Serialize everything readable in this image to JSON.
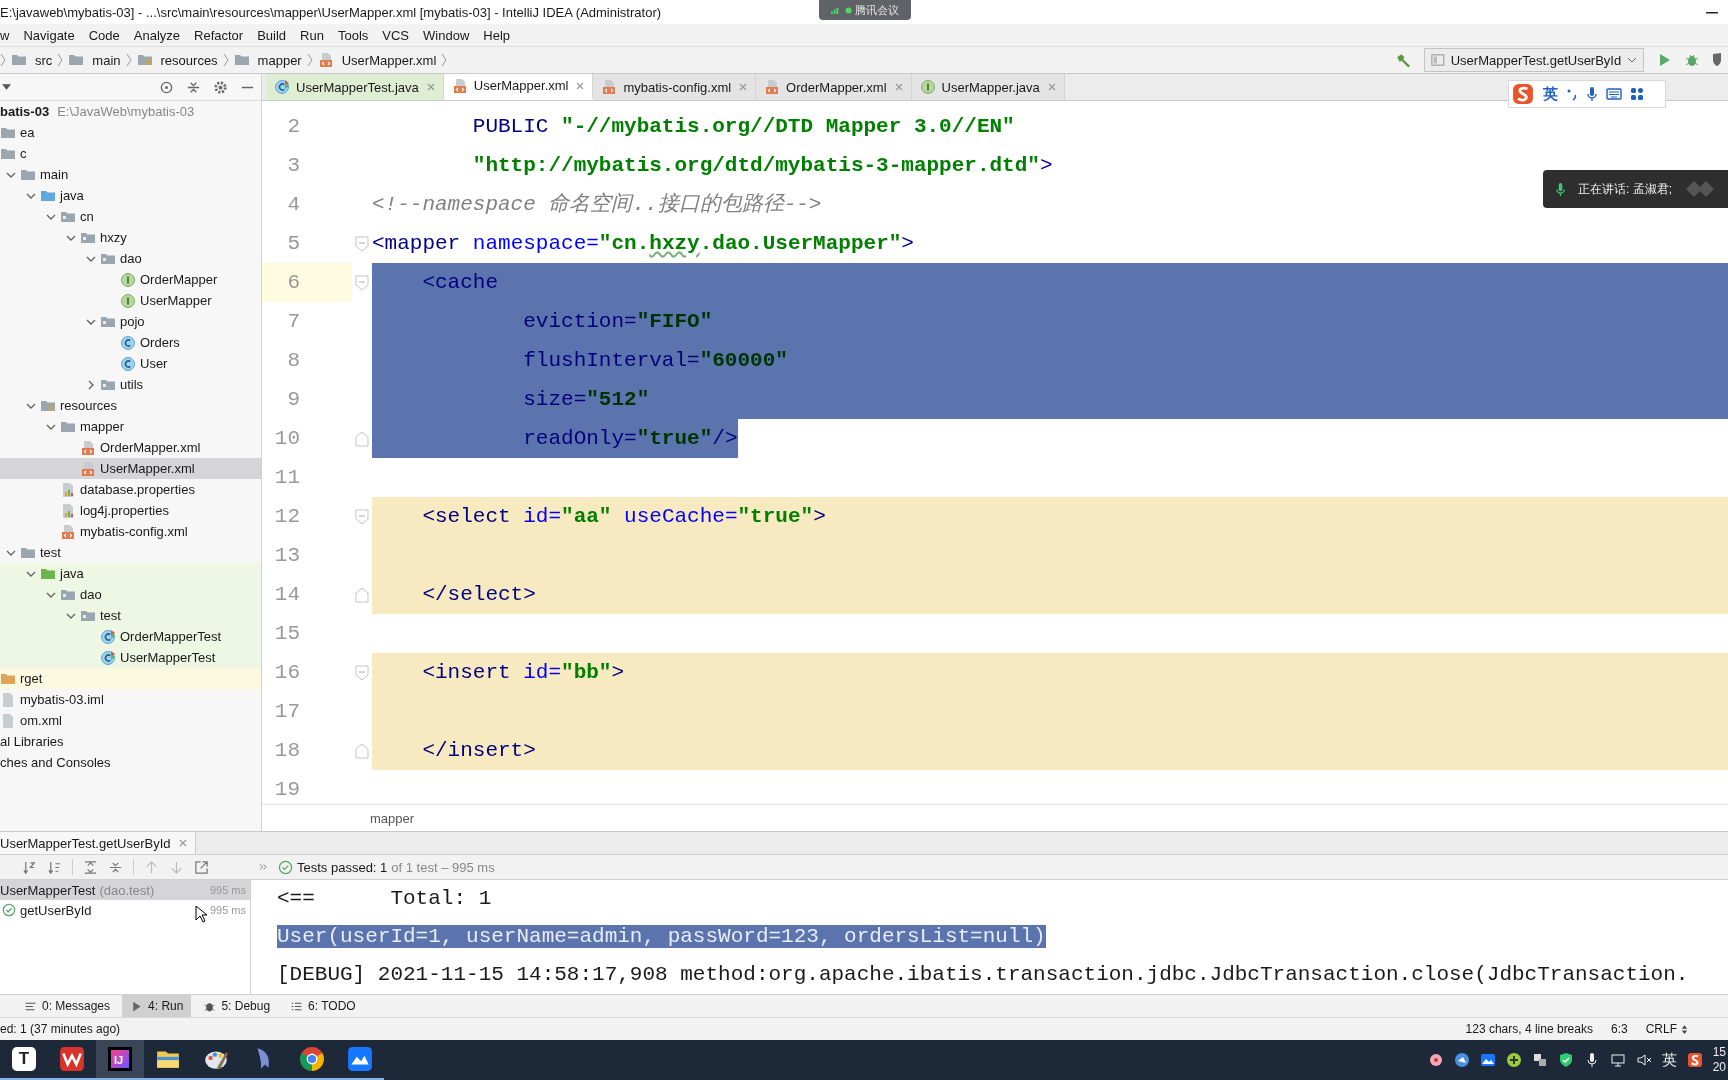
{
  "window": {
    "title": "E:\\javaweb\\mybatis-03] - ...\\src\\main\\resources\\mapper\\UserMapper.xml [mybatis-03] - IntelliJ IDEA (Administrator)"
  },
  "menu": [
    "w",
    "Navigate",
    "Code",
    "Analyze",
    "Refactor",
    "Build",
    "Run",
    "Tools",
    "VCS",
    "Window",
    "Help"
  ],
  "breadcrumb": [
    {
      "label": "src",
      "kind": "folder"
    },
    {
      "label": "main",
      "kind": "folder"
    },
    {
      "label": "resources",
      "kind": "resources-root"
    },
    {
      "label": "mapper",
      "kind": "folder"
    },
    {
      "label": "UserMapper.xml",
      "kind": "xml"
    }
  ],
  "run_config": {
    "label": "UserMapperTest.getUserById"
  },
  "project": {
    "tree": [
      {
        "label": "batis-03",
        "path": "E:\\JavaWeb\\mybatis-03",
        "kind": "module",
        "selected": false,
        "children": [
          {
            "label": "ea",
            "kind": "folder",
            "selected": false
          },
          {
            "label": "c",
            "kind": "folder",
            "selected": false,
            "children": [
              {
                "label": "main",
                "kind": "folder",
                "expanded": true,
                "selected": false,
                "children": [
                  {
                    "label": "java",
                    "kind": "source-root",
                    "expanded": true,
                    "selected": false,
                    "children": [
                      {
                        "label": "cn",
                        "kind": "package",
                        "expanded": true,
                        "selected": false,
                        "children": [
                          {
                            "label": "hxzy",
                            "kind": "package",
                            "expanded": true,
                            "selected": false,
                            "children": [
                              {
                                "label": "dao",
                                "kind": "package",
                                "expanded": true,
                                "selected": false,
                                "children": [
                                  {
                                    "label": "OrderMapper",
                                    "kind": "interface",
                                    "selected": false
                                  },
                                  {
                                    "label": "UserMapper",
                                    "kind": "interface",
                                    "selected": false
                                  }
                                ]
                              },
                              {
                                "label": "pojo",
                                "kind": "package",
                                "expanded": true,
                                "selected": false,
                                "children": [
                                  {
                                    "label": "Orders",
                                    "kind": "class",
                                    "selected": false
                                  },
                                  {
                                    "label": "User",
                                    "kind": "class",
                                    "selected": false
                                  }
                                ]
                              },
                              {
                                "label": "utils",
                                "kind": "package",
                                "expanded": false,
                                "selected": false
                              }
                            ]
                          }
                        ]
                      }
                    ]
                  },
                  {
                    "label": "resources",
                    "kind": "resources-root",
                    "expanded": true,
                    "selected": false,
                    "children": [
                      {
                        "label": "mapper",
                        "kind": "folder",
                        "expanded": true,
                        "selected": false,
                        "children": [
                          {
                            "label": "OrderMapper.xml",
                            "kind": "xml",
                            "selected": false
                          },
                          {
                            "label": "UserMapper.xml",
                            "kind": "xml",
                            "selected": true
                          }
                        ]
                      },
                      {
                        "label": "database.properties",
                        "kind": "properties",
                        "selected": false
                      },
                      {
                        "label": "log4j.properties",
                        "kind": "properties",
                        "selected": false
                      },
                      {
                        "label": "mybatis-config.xml",
                        "kind": "xml",
                        "selected": false
                      }
                    ]
                  }
                ]
              },
              {
                "label": "test",
                "kind": "folder",
                "expanded": true,
                "selected": false,
                "children": [
                  {
                    "label": "java",
                    "kind": "test-root",
                    "expanded": true,
                    "selected": false,
                    "children": [
                      {
                        "label": "dao",
                        "kind": "package",
                        "expanded": true,
                        "selected": false,
                        "children": [
                          {
                            "label": "test",
                            "kind": "package",
                            "expanded": true,
                            "selected": false,
                            "children": [
                              {
                                "label": "OrderMapperTest",
                                "kind": "test-class",
                                "selected": false
                              },
                              {
                                "label": "UserMapperTest",
                                "kind": "test-class",
                                "selected": false
                              }
                            ]
                          }
                        ]
                      }
                    ]
                  }
                ]
              }
            ]
          },
          {
            "label": "rget",
            "kind": "excluded-root",
            "selected": false
          },
          {
            "label": "mybatis-03.iml",
            "kind": "iml",
            "selected": false
          },
          {
            "label": "om.xml",
            "kind": "maven",
            "selected": false
          }
        ]
      },
      {
        "label": "al Libraries",
        "kind": "libraries",
        "selected": false
      },
      {
        "label": "ches and Consoles",
        "kind": "consoles",
        "selected": false
      }
    ]
  },
  "editor": {
    "tabs": [
      {
        "label": "UserMapperTest.java",
        "kind": "test-class",
        "selected": false
      },
      {
        "label": "UserMapper.xml",
        "kind": "xml",
        "selected": true
      },
      {
        "label": "mybatis-config.xml",
        "kind": "xml",
        "selected": false
      },
      {
        "label": "OrderMapper.xml",
        "kind": "xml",
        "selected": false
      },
      {
        "label": "UserMapper.java",
        "kind": "interface",
        "selected": false
      }
    ],
    "lines": [
      {
        "number": "2",
        "selected": false,
        "highlighted": false,
        "current": false,
        "fold_start": false,
        "fold_end": false,
        "tokens": [
          {
            "text": "        PUBLIC ",
            "kind": "tag"
          },
          {
            "text": "\"-//mybatis.org//DTD Mapper 3.0//EN\"",
            "kind": "value"
          }
        ]
      },
      {
        "number": "3",
        "selected": false,
        "highlighted": false,
        "current": false,
        "fold_start": false,
        "fold_end": false,
        "tokens": [
          {
            "text": "        \"http://mybatis.org/dtd/mybatis-3-mapper.dtd\"",
            "kind": "value"
          },
          {
            "text": ">",
            "kind": "tag"
          }
        ]
      },
      {
        "number": "4",
        "selected": false,
        "highlighted": false,
        "current": false,
        "fold_start": false,
        "fold_end": false,
        "tokens": [
          {
            "text": "<!--namespace 命名空间..接口的包路径-->",
            "kind": "comment"
          }
        ]
      },
      {
        "number": "5",
        "selected": false,
        "highlighted": false,
        "current": false,
        "fold_start": true,
        "fold_end": false,
        "tokens": [
          {
            "text": "<mapper ",
            "kind": "tag"
          },
          {
            "text": "namespace=",
            "kind": "attr"
          },
          {
            "text": "\"cn.",
            "kind": "value"
          },
          {
            "text": "hxzy",
            "kind": "typo"
          },
          {
            "text": ".dao.UserMapper\"",
            "kind": "value"
          },
          {
            "text": ">",
            "kind": "tag"
          }
        ]
      },
      {
        "number": "6",
        "selected": true,
        "full_width": true,
        "highlighted": false,
        "current": true,
        "fold_start": true,
        "fold_end": false,
        "tokens": [
          {
            "text": "    <cache",
            "kind": "tag"
          }
        ]
      },
      {
        "number": "7",
        "selected": true,
        "full_width": true,
        "highlighted": false,
        "current": false,
        "fold_start": false,
        "fold_end": false,
        "tokens": [
          {
            "text": "            eviction=",
            "kind": "attr"
          },
          {
            "text": "\"FIFO\"",
            "kind": "value"
          }
        ]
      },
      {
        "number": "8",
        "selected": true,
        "full_width": true,
        "highlighted": false,
        "current": false,
        "fold_start": false,
        "fold_end": false,
        "tokens": [
          {
            "text": "            flushInterval=",
            "kind": "attr"
          },
          {
            "text": "\"60000\"",
            "kind": "value"
          }
        ]
      },
      {
        "number": "9",
        "selected": true,
        "full_width": true,
        "highlighted": false,
        "current": false,
        "fold_start": false,
        "fold_end": false,
        "tokens": [
          {
            "text": "            size=",
            "kind": "attr"
          },
          {
            "text": "\"512\"",
            "kind": "value"
          }
        ]
      },
      {
        "number": "10",
        "selected": true,
        "full_width": false,
        "highlighted": false,
        "current": false,
        "fold_start": false,
        "fold_end": true,
        "tokens": [
          {
            "text": "            readOnly=",
            "kind": "attr"
          },
          {
            "text": "\"true\"",
            "kind": "value"
          },
          {
            "text": "/>",
            "kind": "tag"
          }
        ]
      },
      {
        "number": "11",
        "selected": false,
        "highlighted": false,
        "current": false,
        "fold_start": false,
        "fold_end": false
      },
      {
        "number": "12",
        "selected": false,
        "highlighted": true,
        "current": false,
        "fold_start": true,
        "fold_end": false,
        "tokens": [
          {
            "text": "    <select ",
            "kind": "tag"
          },
          {
            "text": "id=",
            "kind": "attr"
          },
          {
            "text": "\"aa\"",
            "kind": "value"
          },
          {
            "text": " useCache=",
            "kind": "attr"
          },
          {
            "text": "\"true\"",
            "kind": "value"
          },
          {
            "text": ">",
            "kind": "tag"
          }
        ]
      },
      {
        "number": "13",
        "selected": false,
        "highlighted": true,
        "current": false,
        "fold_start": false,
        "fold_end": false
      },
      {
        "number": "14",
        "selected": false,
        "highlighted": true,
        "current": false,
        "fold_start": false,
        "fold_end": true,
        "tokens": [
          {
            "text": "    </select>",
            "kind": "tag"
          }
        ]
      },
      {
        "number": "15",
        "selected": false,
        "highlighted": false,
        "current": false,
        "fold_start": false,
        "fold_end": false
      },
      {
        "number": "16",
        "selected": false,
        "highlighted": true,
        "current": false,
        "fold_start": true,
        "fold_end": false,
        "tokens": [
          {
            "text": "    <insert ",
            "kind": "tag"
          },
          {
            "text": "id=",
            "kind": "attr"
          },
          {
            "text": "\"bb\"",
            "kind": "value"
          },
          {
            "text": ">",
            "kind": "tag"
          }
        ]
      },
      {
        "number": "17",
        "selected": false,
        "highlighted": true,
        "current": false,
        "fold_start": false,
        "fold_end": false
      },
      {
        "number": "18",
        "selected": false,
        "highlighted": true,
        "current": false,
        "fold_start": false,
        "fold_end": true,
        "tokens": [
          {
            "text": "    </insert>",
            "kind": "tag"
          }
        ]
      },
      {
        "number": "19",
        "selected": false,
        "highlighted": false,
        "current": false,
        "fold_start": false,
        "fold_end": false
      }
    ],
    "breadcrumb": "mapper"
  },
  "run": {
    "tab": "UserMapperTest.getUserById",
    "summary": "Tests passed: 1",
    "summary_detail": "of 1 test – 995 ms",
    "tests": [
      {
        "label": "UserMapperTest",
        "detail": "(dao.test)",
        "time": "995 ms",
        "selected": true,
        "children": [
          {
            "label": "getUserById",
            "time": "995 ms",
            "selected": false
          }
        ]
      }
    ],
    "console": [
      {
        "text": "<==      Total: 1",
        "selected": false
      },
      {
        "text": "User(userId=1, userName=admin, passWord=123, ordersList=null)",
        "selected": true
      },
      {
        "text": "[DEBUG] 2021-11-15 14:58:17,908 method:org.apache.ibatis.transaction.jdbc.JdbcTransaction.close(JdbcTransaction.",
        "selected": false
      }
    ]
  },
  "tool_windows": [
    {
      "label": "0: Messages",
      "kind": "messages",
      "selected": false
    },
    {
      "label": "4: Run",
      "kind": "run",
      "selected": true
    },
    {
      "label": "5: Debug",
      "kind": "debug",
      "selected": false
    },
    {
      "label": "6: TODO",
      "kind": "todo",
      "selected": false
    }
  ],
  "status_bar": {
    "message": "ed: 1 (37 minutes ago)",
    "items": [
      "123 chars, 4 line breaks",
      "6:3",
      "CRLF"
    ]
  },
  "taskbar": {
    "apps": [
      {
        "kind": "letter",
        "glyph": "T",
        "selected": false
      },
      {
        "kind": "wps",
        "selected": false
      },
      {
        "kind": "intellij",
        "glyph": "IJ",
        "selected": true
      },
      {
        "kind": "folder",
        "selected": false
      },
      {
        "kind": "paint",
        "selected": false
      },
      {
        "kind": "dolphin",
        "selected": false
      },
      {
        "kind": "chrome",
        "selected": false
      },
      {
        "kind": "lark",
        "selected": false
      }
    ],
    "ime": "英",
    "clock": [
      "15",
      "20"
    ]
  },
  "ime_toolbar": {
    "mode": "英"
  },
  "meeting": {
    "badge": "腾讯会议",
    "speaking": "正在讲话: 孟淑君;"
  }
}
